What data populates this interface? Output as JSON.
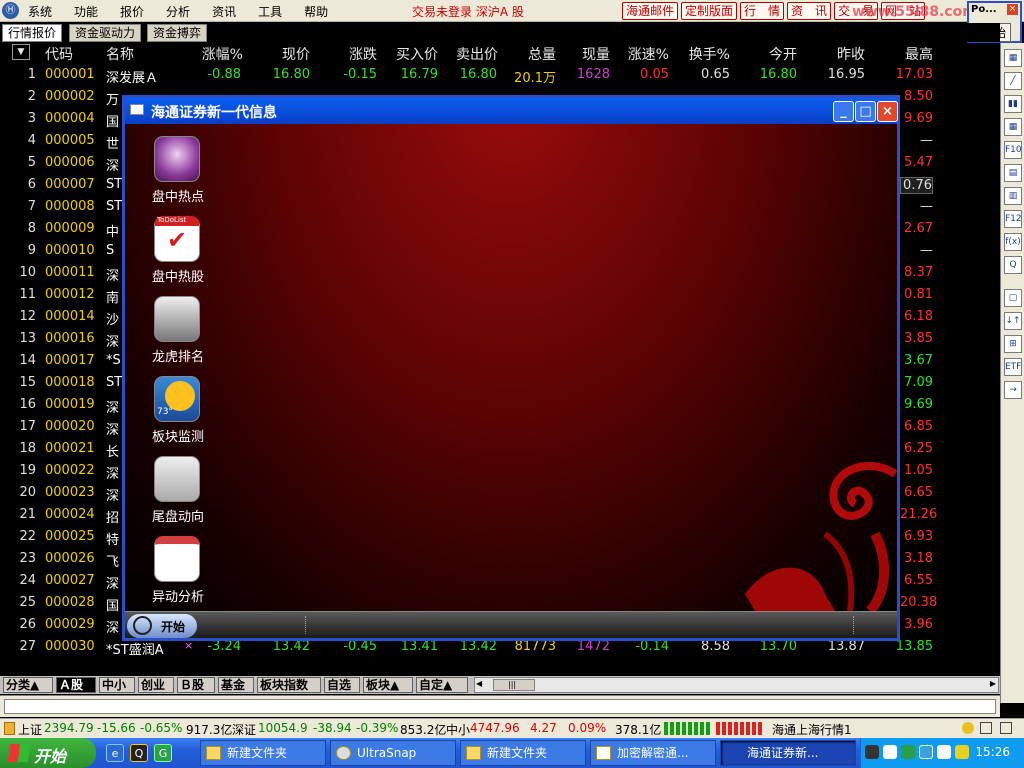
{
  "menubar": {
    "logo_glyph": "Ⓗ",
    "items": [
      "系统",
      "功能",
      "报价",
      "分析",
      "资讯",
      "工具",
      "帮助"
    ],
    "login_status": "交易未登录 深沪A 股",
    "buttons": [
      "海通邮件",
      "定制版面",
      "行　情",
      "资　讯",
      "交　易",
      "网　站"
    ],
    "watermark": "www.55i88.com"
  },
  "corner_box": {
    "title": "Po...",
    "close": "×",
    "start": "开始"
  },
  "tabs": [
    "行情报价",
    "资金驱动力",
    "资金搏弈"
  ],
  "header": {
    "sort_arrow": "▼",
    "columns": [
      "代码",
      "名称",
      "涨幅%",
      "现价",
      "涨跌",
      "买入价",
      "卖出价",
      "总量",
      "现量",
      "涨速%",
      "换手%",
      "今开",
      "昨收",
      "最高"
    ]
  },
  "first_row": {
    "num": "1",
    "code": "000001",
    "name": "深发展Ａ",
    "values": [
      "-0.88",
      "16.80",
      "-0.15",
      "16.79",
      "16.80",
      "20.1万",
      "1628",
      "0.05",
      "0.65",
      "16.80",
      "16.95",
      "17.03"
    ]
  },
  "rows": [
    {
      "num": "2",
      "code": "000002",
      "name": "万",
      "last": "8.50"
    },
    {
      "num": "3",
      "code": "000004",
      "name": "国",
      "last": "9.69"
    },
    {
      "num": "4",
      "code": "000005",
      "name": "世",
      "last": "—"
    },
    {
      "num": "5",
      "code": "000006",
      "name": "深",
      "last": "5.47"
    },
    {
      "num": "6",
      "code": "000007",
      "name": "ST",
      "last": "0.76"
    },
    {
      "num": "7",
      "code": "000008",
      "name": "ST",
      "last": "—"
    },
    {
      "num": "8",
      "code": "000009",
      "name": "中",
      "last": "2.67"
    },
    {
      "num": "9",
      "code": "000010",
      "name": "S",
      "last": "—"
    },
    {
      "num": "10",
      "code": "000011",
      "name": "深",
      "last": "8.37"
    },
    {
      "num": "11",
      "code": "000012",
      "name": "南",
      "last": "0.81"
    },
    {
      "num": "12",
      "code": "000014",
      "name": "沙",
      "last": "6.18"
    },
    {
      "num": "13",
      "code": "000016",
      "name": "深",
      "last": "3.85"
    },
    {
      "num": "14",
      "code": "000017",
      "name": "*S",
      "last": "3.67"
    },
    {
      "num": "15",
      "code": "000018",
      "name": "ST",
      "last": "7.09"
    },
    {
      "num": "16",
      "code": "000019",
      "name": "深",
      "last": "9.69"
    },
    {
      "num": "17",
      "code": "000020",
      "name": "深",
      "last": "6.85"
    },
    {
      "num": "18",
      "code": "000021",
      "name": "长",
      "last": "6.25"
    },
    {
      "num": "19",
      "code": "000022",
      "name": "深",
      "last": "1.05"
    },
    {
      "num": "20",
      "code": "000023",
      "name": "深",
      "last": "6.65"
    },
    {
      "num": "21",
      "code": "000024",
      "name": "招",
      "last": "21.26"
    },
    {
      "num": "22",
      "code": "000025",
      "name": "特",
      "last": "6.93"
    },
    {
      "num": "23",
      "code": "000026",
      "name": "飞",
      "last": "3.18"
    },
    {
      "num": "24",
      "code": "000027",
      "name": "深",
      "last": "6.55"
    },
    {
      "num": "25",
      "code": "000028",
      "name": "国",
      "last": "20.38"
    },
    {
      "num": "26",
      "code": "000029",
      "name": "深",
      "last": "3.96"
    }
  ],
  "last_row": {
    "num": "27",
    "code": "000030",
    "name": "*ST盛润A",
    "mark": "×",
    "values": [
      "-3.24",
      "13.42",
      "-0.45",
      "13.41",
      "13.42",
      "81773",
      "1472",
      "-0.14",
      "8.58",
      "13.70",
      "13.87",
      "13.85"
    ]
  },
  "sidebar": [
    "▦",
    "╱",
    "▮▮",
    "▦",
    "F10",
    "▤",
    "▥",
    "F12",
    "f(x)",
    "Q",
    "▢",
    "↓↑",
    "⊞",
    "ETF",
    "→"
  ],
  "bottom_tabs": [
    "分类▲",
    "Ａ股",
    "中小",
    "创业",
    "Ｂ股",
    "基金",
    "板块指数",
    "自选",
    "板块▲",
    "自定▲"
  ],
  "scroll": {
    "left": "◀",
    "right": "▶",
    "thumb": "|||"
  },
  "status": {
    "sh_label": "上证",
    "sh_index": "2394.79",
    "sh_change": "-15.66",
    "sh_pct": "-0.65%",
    "sh_amount": "917.3亿",
    "sz_label": "深证",
    "sz_index": "10054.9",
    "sz_change": "-38.94",
    "sz_pct": "-0.39%",
    "sz_amount": "853.2亿",
    "zx_label": "中小",
    "zx_index": "4747.96",
    "zx_change": "4.27",
    "zx_pct": "0.09%",
    "zx_amount": "378.1亿",
    "server": "海通上海行情1"
  },
  "popup": {
    "title": "海通证券新一代信息",
    "minimize": "_",
    "maximize": "□",
    "close": "×",
    "items": [
      "盘中热点",
      "盘中热股",
      "龙虎排名",
      "板块监测",
      "尾盘动向",
      "异动分析"
    ],
    "todo_label": "ToDoList",
    "weather_temp": "73°",
    "start": "开始"
  },
  "taskbar": {
    "start": "开始",
    "quick": [
      "e",
      "Q",
      "G"
    ],
    "tasks": [
      "新建文件夹",
      "UltraSnap",
      "新建文件夹",
      "加密解密通...",
      "海通证券新..."
    ],
    "clock": "15:26"
  },
  "colors": {
    "up": "#ff3030",
    "down": "#30e030",
    "code": "#f0d000",
    "volume": "#d040d0",
    "accent": "#2a4fc9"
  }
}
